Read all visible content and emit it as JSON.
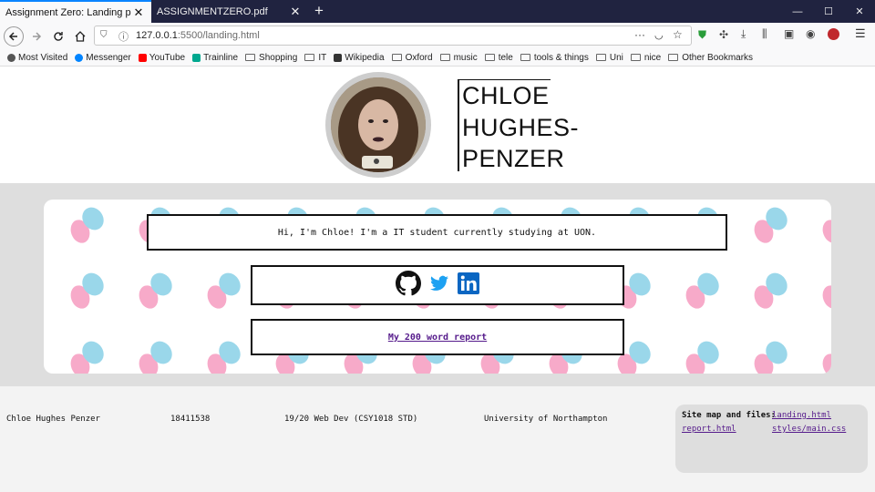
{
  "browser": {
    "tabs": [
      {
        "title": "Assignment Zero: Landing page",
        "active": true
      },
      {
        "title": "ASSIGNMENTZERO.pdf",
        "active": false
      }
    ],
    "url": {
      "host": "127.0.0.1",
      "rest": ":5500/landing.html"
    },
    "bookmarks": [
      {
        "label": "Most Visited",
        "icon": "gear-icon"
      },
      {
        "label": "Messenger",
        "icon": "messenger-icon"
      },
      {
        "label": "YouTube",
        "icon": "youtube-icon"
      },
      {
        "label": "Trainline",
        "icon": "trainline-icon"
      },
      {
        "label": "Shopping",
        "icon": "folder-icon"
      },
      {
        "label": "IT",
        "icon": "folder-icon"
      },
      {
        "label": "Wikipedia",
        "icon": "wikipedia-icon"
      },
      {
        "label": "Oxford",
        "icon": "folder-icon"
      },
      {
        "label": "music",
        "icon": "folder-icon"
      },
      {
        "label": "tele",
        "icon": "folder-icon"
      },
      {
        "label": "tools & things",
        "icon": "folder-icon"
      },
      {
        "label": "Uni",
        "icon": "folder-icon"
      },
      {
        "label": "nice",
        "icon": "folder-icon"
      },
      {
        "label": "Other Bookmarks",
        "icon": "folder-icon"
      }
    ]
  },
  "header": {
    "name_lines": [
      "CHLOE",
      "HUGHES-",
      "PENZER"
    ]
  },
  "main": {
    "intro": "Hi, I'm Chloe! I'm a IT student currently studying at UON.",
    "social": [
      "github-icon",
      "twitter-icon",
      "linkedin-icon"
    ],
    "report_link": "My 200 word report"
  },
  "footer": {
    "name": "Chloe Hughes Penzer",
    "student_id": "18411538",
    "module": "19/20 Web Dev (CSY1018 STD)",
    "university": "University of Northampton",
    "sitemap": {
      "title": "Site map and files:",
      "links": [
        "landing.html",
        "report.html",
        "styles/main.css"
      ]
    }
  },
  "colors": {
    "pink_blob": "#f7aac9",
    "blue_blob": "#9ad7ea",
    "link": "#551a8b",
    "tabbar": "#202340"
  }
}
